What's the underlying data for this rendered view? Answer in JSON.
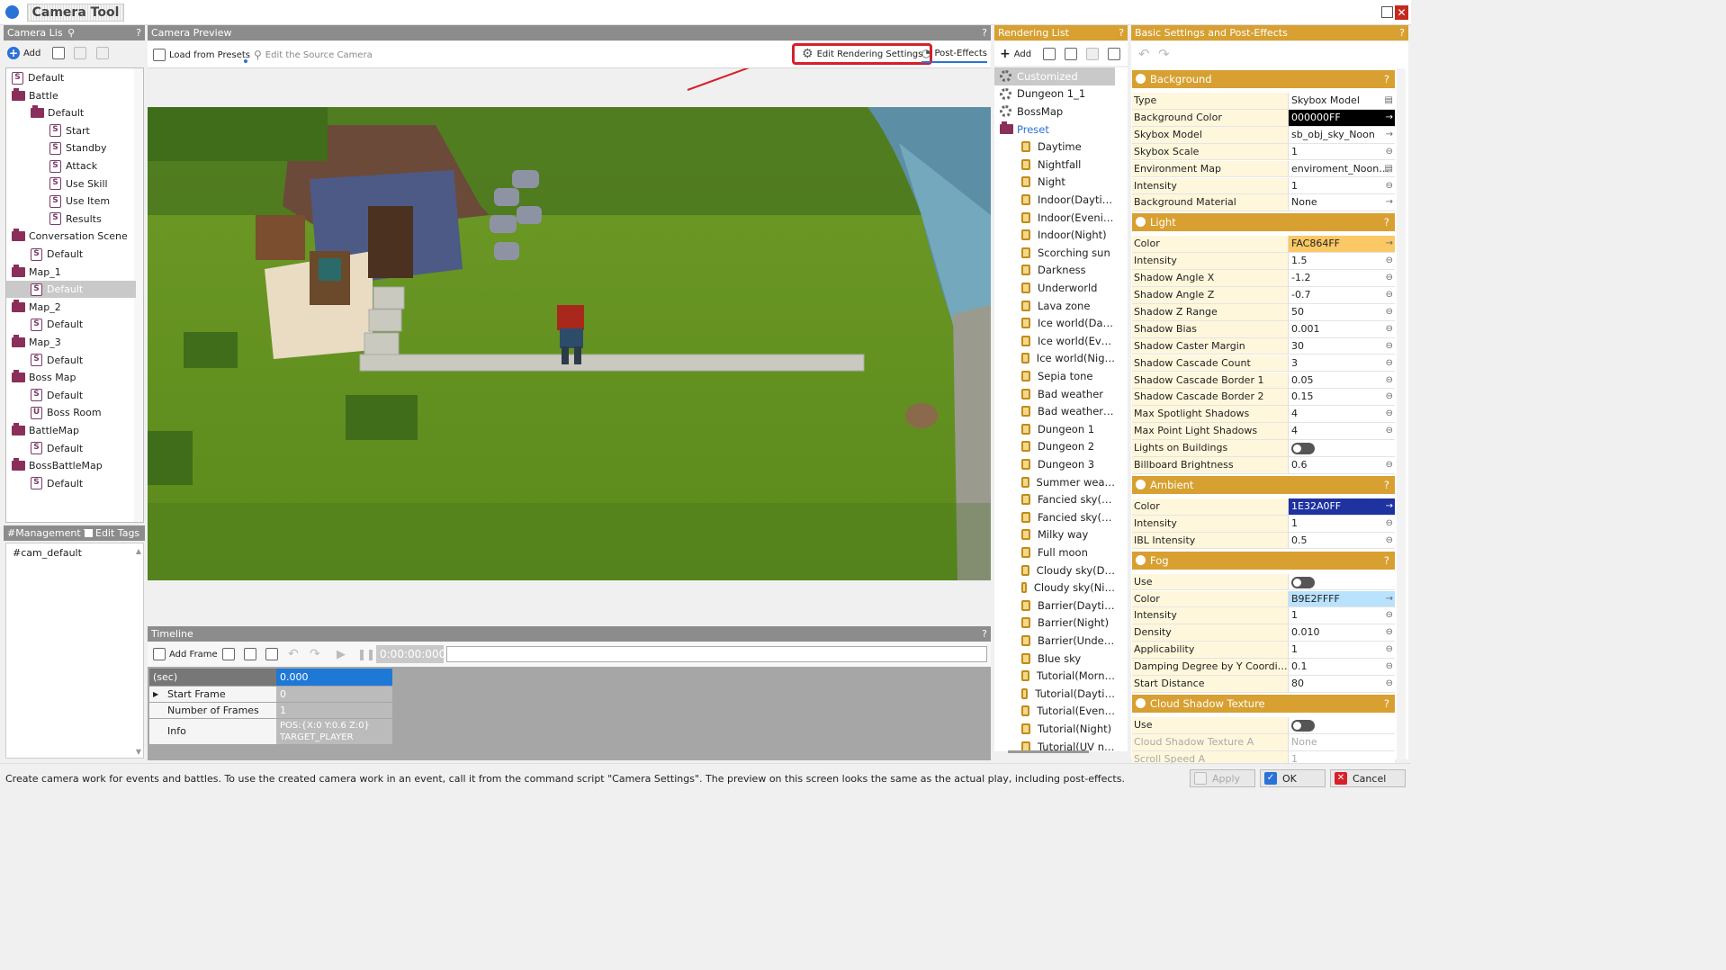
{
  "window": {
    "title": "Camera Tool"
  },
  "camera_list": {
    "header": "Camera Lis",
    "help": "?",
    "add_label": "Add",
    "tree": [
      {
        "label": "Default",
        "type": "s"
      },
      {
        "label": "Battle",
        "type": "folder"
      },
      {
        "label": "Default",
        "type": "folder"
      },
      {
        "label": "Start",
        "type": "s"
      },
      {
        "label": "Standby",
        "type": "s"
      },
      {
        "label": "Attack",
        "type": "s"
      },
      {
        "label": "Use Skill",
        "type": "s"
      },
      {
        "label": "Use Item",
        "type": "s"
      },
      {
        "label": "Results",
        "type": "s"
      },
      {
        "label": "Conversation Scene",
        "type": "folder"
      },
      {
        "label": "Default",
        "type": "s"
      },
      {
        "label": "Map_1",
        "type": "folder"
      },
      {
        "label": "Default",
        "type": "s",
        "selected": true
      },
      {
        "label": "Map_2",
        "type": "folder"
      },
      {
        "label": "Default",
        "type": "s"
      },
      {
        "label": "Map_3",
        "type": "folder"
      },
      {
        "label": "Default",
        "type": "s"
      },
      {
        "label": "Boss Map",
        "type": "folder"
      },
      {
        "label": "Default",
        "type": "s"
      },
      {
        "label": "Boss Room",
        "type": "u"
      },
      {
        "label": "BattleMap",
        "type": "folder"
      },
      {
        "label": "Default",
        "type": "s"
      },
      {
        "label": "BossBattleMap",
        "type": "folder"
      },
      {
        "label": "Default",
        "type": "s"
      }
    ]
  },
  "management": {
    "header": "#Management T",
    "edit_tags": "Edit Tags",
    "tags": [
      "#cam_default"
    ]
  },
  "preview": {
    "header": "Camera Preview",
    "help": "?",
    "load_presets": "Load from Presets",
    "edit_source": "Edit the Source Camera",
    "edit_rendering": "Edit Rendering Settings",
    "post_effects": "Post-Effects"
  },
  "timeline": {
    "header": "Timeline",
    "help": "?",
    "add_frame": "Add Frame",
    "time": "0:00:00:000",
    "rows": [
      {
        "key": "(sec)",
        "value": "0.000"
      },
      {
        "key": "Start Frame",
        "value": "0"
      },
      {
        "key": "Number of Frames",
        "value": "1"
      },
      {
        "key": "Info",
        "value": "POS:{X:0 Y:0.6 Z:0}",
        "value2": "TARGET_PLAYER"
      }
    ]
  },
  "rendering_list": {
    "header": "Rendering List",
    "help": "?",
    "add_label": "Add",
    "customized_label": "Customized",
    "custom_items": [
      "Dungeon 1_1",
      "BossMap"
    ],
    "preset_label": "Preset",
    "presets": [
      "Daytime",
      "Nightfall",
      "Night",
      "Indoor(Dayti…",
      "Indoor(Eveni…",
      "Indoor(Night)",
      "Scorching sun",
      "Darkness",
      "Underworld",
      "Lava zone",
      "Ice world(Da…",
      "Ice world(Ev…",
      "Ice world(Nig…",
      "Sepia tone",
      "Bad weather",
      "Bad weather…",
      "Dungeon 1",
      "Dungeon 2",
      "Dungeon 3",
      "Summer wea…",
      "Fancied sky(…",
      "Fancied sky(…",
      "Milky way",
      "Full moon",
      "Cloudy sky(D…",
      "Cloudy sky(Ni…",
      "Barrier(Dayti…",
      "Barrier(Night)",
      "Barrier(Unde…",
      "Blue sky",
      "Tutorial(Morn…",
      "Tutorial(Dayti…",
      "Tutorial(Even…",
      "Tutorial(Night)",
      "Tutorial(UV n…"
    ]
  },
  "settings": {
    "header": "Basic Settings and Post-Effects",
    "help": "?",
    "sections": [
      {
        "title": "Background",
        "rows": [
          {
            "k": "Type",
            "v": "Skybox Model",
            "a": "▤"
          },
          {
            "k": "Background Color",
            "v": "000000FF",
            "a": "→",
            "bg": "#000000",
            "fg": "#ffffff"
          },
          {
            "k": "Skybox Model",
            "v": "sb_obj_sky_Noon",
            "a": "→"
          },
          {
            "k": "Skybox Scale",
            "v": "1",
            "a": "⊖"
          },
          {
            "k": "Environment Map",
            "v": "enviroment_Noon…",
            "a": "▤"
          },
          {
            "k": "Intensity",
            "v": "1",
            "a": "⊖"
          },
          {
            "k": "Background Material",
            "v": "None",
            "a": "→"
          }
        ]
      },
      {
        "title": "Light",
        "rows": [
          {
            "k": "Color",
            "v": "FAC864FF",
            "a": "→",
            "bg": "#fac864",
            "fg": "#222222"
          },
          {
            "k": "Intensity",
            "v": "1.5",
            "a": "⊖"
          },
          {
            "k": "Shadow Angle X",
            "v": "-1.2",
            "a": "⊖"
          },
          {
            "k": "Shadow Angle Z",
            "v": "-0.7",
            "a": "⊖"
          },
          {
            "k": "Shadow Z Range",
            "v": "50",
            "a": "⊖"
          },
          {
            "k": "Shadow Bias",
            "v": "0.001",
            "a": "⊖"
          },
          {
            "k": "Shadow Caster Margin",
            "v": "30",
            "a": "⊖"
          },
          {
            "k": "Shadow Cascade Count",
            "v": "3",
            "a": "⊖"
          },
          {
            "k": "Shadow Cascade Border 1",
            "v": "0.05",
            "a": "⊖"
          },
          {
            "k": "Shadow Cascade Border 2",
            "v": "0.15",
            "a": "⊖"
          },
          {
            "k": "Max Spotlight Shadows",
            "v": "4",
            "a": "⊖"
          },
          {
            "k": "Max Point Light Shadows",
            "v": "4",
            "a": "⊖"
          },
          {
            "k": "Lights on Buildings",
            "v": "",
            "toggle": true
          },
          {
            "k": "Billboard Brightness",
            "v": "0.6",
            "a": "⊖"
          }
        ]
      },
      {
        "title": "Ambient",
        "rows": [
          {
            "k": "Color",
            "v": "1E32A0FF",
            "a": "→",
            "bg": "#1e32a0",
            "fg": "#ffffff"
          },
          {
            "k": "Intensity",
            "v": "1",
            "a": "⊖"
          },
          {
            "k": "IBL Intensity",
            "v": "0.5",
            "a": "⊖"
          }
        ]
      },
      {
        "title": "Fog",
        "rows": [
          {
            "k": "Use",
            "v": "",
            "toggle": true
          },
          {
            "k": "Color",
            "v": "B9E2FFFF",
            "a": "→",
            "bg": "#b9e2ff",
            "fg": "#222222"
          },
          {
            "k": "Intensity",
            "v": "1",
            "a": "⊖"
          },
          {
            "k": "Density",
            "v": "0.010",
            "a": "⊖"
          },
          {
            "k": "Applicability",
            "v": "1",
            "a": "⊖"
          },
          {
            "k": "Damping Degree by Y Coordi…",
            "v": "0.1",
            "a": "⊖"
          },
          {
            "k": "Start Distance",
            "v": "80",
            "a": "⊖"
          }
        ]
      },
      {
        "title": "Cloud Shadow Texture",
        "rows": [
          {
            "k": "Use",
            "v": "",
            "toggle": true
          },
          {
            "k": "Cloud Shadow Texture A",
            "v": "None",
            "a": ""
          },
          {
            "k": "Scroll Speed A",
            "v": "1",
            "a": ""
          }
        ]
      }
    ]
  },
  "status_bar": {
    "text": "Create camera work for events and battles. To use the created camera work in an event, call it from the command script \"Camera Settings\". The preview on this screen looks the same as the actual play, including post-effects.",
    "apply": "Apply",
    "ok": "OK",
    "cancel": "Cancel"
  }
}
